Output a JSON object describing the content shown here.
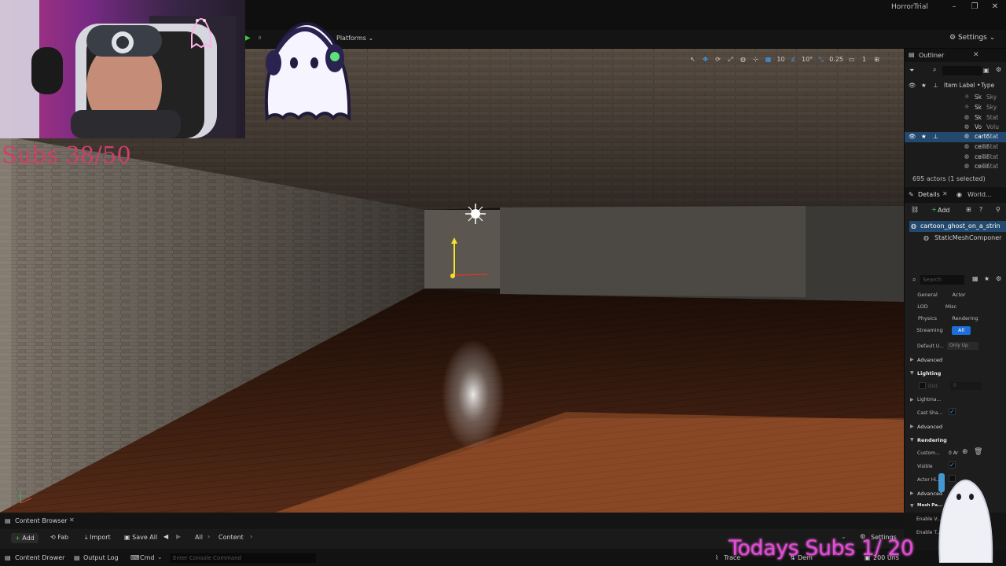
{
  "window": {
    "title": "HorrorTrial",
    "minimize": "–",
    "restore": "❐",
    "close": "✕"
  },
  "toolbar": {
    "platforms_label": "Platforms",
    "settings_label": "Settings"
  },
  "viewport_toolbar": {
    "select_icon": "arrow-icon",
    "grid_snap_value": "10",
    "rotation_snap_value": "10°",
    "scale_snap_value": "0.25",
    "camera_speed_value": "1"
  },
  "overlay": {
    "subs_counter": "Subs 38/50",
    "todays_subs": "Todays Subs 1/ 20"
  },
  "outliner": {
    "tab_label": "Outliner",
    "column_label": "Item Label",
    "column_type": "Type",
    "rows": [
      {
        "name": "Sk",
        "type": "Sky"
      },
      {
        "name": "Sk",
        "type": "Sky"
      },
      {
        "name": "Sk",
        "type": "Stat"
      },
      {
        "name": "Vo",
        "type": "Volu"
      },
      {
        "name": "cartc",
        "type": "Stat"
      },
      {
        "name": "ceilir",
        "type": "Stat"
      },
      {
        "name": "ceilir",
        "type": "Stat"
      },
      {
        "name": "ceilir",
        "type": "Stat"
      }
    ],
    "actor_count": "695 actors (1 selected)"
  },
  "details": {
    "tab_label": "Details",
    "world_tab_label": "World...",
    "add_label": "Add",
    "selected_actor": "cartoon_ghost_on_a_strin",
    "component": "StaticMeshComponer",
    "search_placeholder": "Search",
    "filters": [
      "General",
      "Actor",
      "LOD",
      "Misc",
      "Physics",
      "Rendering",
      "Streaming",
      "All"
    ],
    "default_update_label": "Default U...",
    "default_update_value": "Only Up",
    "advanced_1": "Advanced",
    "lighting_header": "Lighting",
    "lighting_dist": "Dist",
    "lighting_dist_value": "0",
    "lightmap_label": "Lightma...",
    "cast_shadow_label": "Cast Sha...",
    "advanced_2": "Advanced",
    "rendering_header": "Rendering",
    "custom_label": "Custom...",
    "custom_value": "0 Ar",
    "visible_label": "Visible",
    "actor_hidden_label": "Actor Hi...",
    "advanced_3": "Advanced",
    "mesh_header": "Mesh Pa...",
    "enable_v_label": "Enable V...",
    "enable_t_label": "Enable T..."
  },
  "content_browser": {
    "tab_label": "Content Browser",
    "add_label": "Add",
    "fab_label": "Fab",
    "import_label": "Import",
    "save_all_label": "Save All",
    "path_all": "All",
    "path_content": "Content",
    "settings_label": "Settings"
  },
  "statusbar": {
    "content_drawer": "Content Drawer",
    "output_log": "Output Log",
    "cmd": "Cmd",
    "console_placeholder": "Enter Console Command",
    "trace": "Trace",
    "derived": "Dem",
    "unsaved": "200 Uns"
  },
  "colors": {
    "accent": "#1c6fd8",
    "play_green": "#3dc43d",
    "subs_counter": "#cf3f6a",
    "todays_subs": "#e24cd7"
  }
}
